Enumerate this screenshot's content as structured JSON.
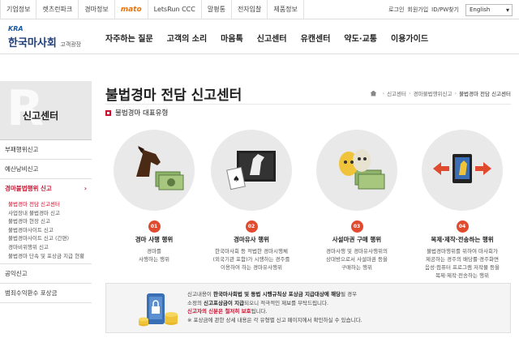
{
  "topbar": {
    "links": [
      "기업정보",
      "렛츠런파크",
      "경마정보",
      "mato",
      "LetsRun CCC",
      "말평통",
      "전자입찰",
      "제품정보"
    ],
    "util": [
      "로그인",
      "회원가입",
      "ID/PW찾기"
    ],
    "language": "English"
  },
  "header": {
    "logo_abbr": "KRA",
    "logo_name": "한국마사회",
    "logo_sub": "고객광장",
    "nav": [
      "자주하는 질문",
      "고객의 소리",
      "마음톡",
      "신고센터",
      "유캔센터",
      "약도·교통",
      "이용가이드"
    ]
  },
  "sidebar": {
    "title": "신고센터",
    "items": [
      "부패행위신고",
      "예산낭비신고",
      "경마불법행위 신고",
      "공익신고",
      "범죄수익환수 포상금"
    ],
    "sub_items": [
      "불법경마 전담 신고센터",
      "사업장내 불법경마 신고",
      "불법경마 현장 신고",
      "불법경마사이트 신고",
      "불법경마사이트 신고 (간편)",
      "경마비위행위 신고",
      "불법경마 단속 및 포상금 지급 현황"
    ]
  },
  "main": {
    "title": "불법경마 전담 신고센터",
    "breadcrumb": [
      "신고센터",
      "경마불법행위신고",
      "불법경마 전담 신고센터"
    ],
    "section_title": "불법경마 대표유형",
    "cards": [
      {
        "num": "01",
        "title": "경마 사행 행위",
        "desc": [
          "경마를",
          "사행하는 행위"
        ]
      },
      {
        "num": "02",
        "title": "경마유사 행위",
        "desc": [
          "한국마사회 등 적법한 경마시행체",
          "(외국기관 포함)가 시행하는 경주를",
          "이용하여 하는 경마유사행위"
        ]
      },
      {
        "num": "03",
        "title": "사설마권 구매 행위",
        "desc": [
          "경마사행 및 경마유사행위의",
          "상대방으로서 사설마권 등을",
          "구매하는 행위"
        ]
      },
      {
        "num": "04",
        "title": "복제·제작·전송하는 행위",
        "desc": [
          "불법경마행위를 위하여 마사회가",
          "제공하는 경주의 배당률·경주화면",
          "음성·컴퓨터 프로그램 저작물 등을",
          "복제·제작·전송하는 행위"
        ]
      }
    ]
  },
  "notice": {
    "l1a": "신고내용이 ",
    "l1b": "한국마사회법 및 동법 시행규칙상 포상금 지급대상에 해당",
    "l1c": "될 경우",
    "l2a": "소정의 ",
    "l2b": "신고포상금이 지급",
    "l2c": "되오니 적극적인 제보를 부탁드립니다.",
    "l3": "신고자의 신분은 철저히 보호",
    "l3c": "됩니다.",
    "l4": "※ 포상금에 관한 상세 내용은 각 유형별 신고 페이지에서 확인하실 수 있습니다."
  },
  "colors": {
    "accent": "#c8102e",
    "badge": "#e04a2f",
    "circle": "#e9e9e9"
  }
}
